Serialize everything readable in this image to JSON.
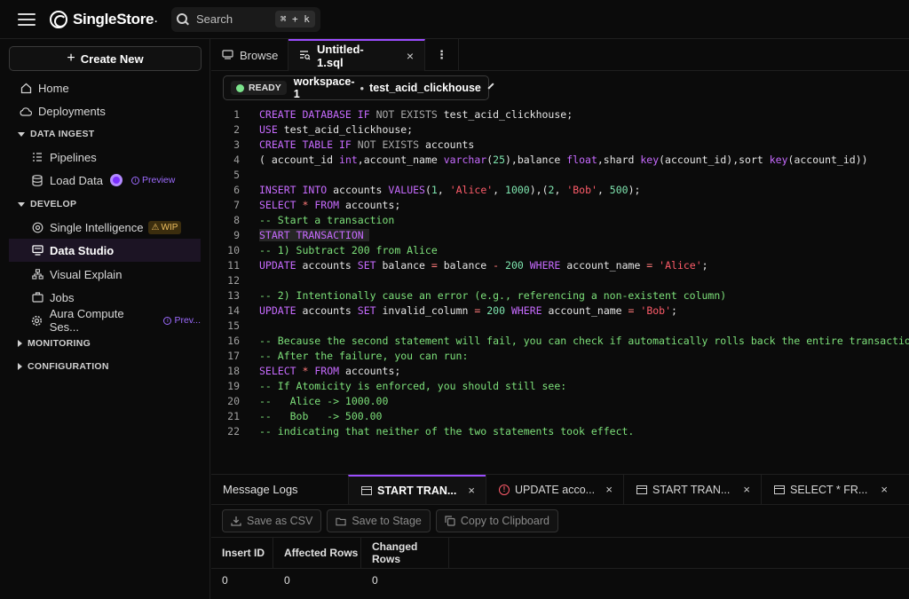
{
  "header": {
    "brand": "SingleStore",
    "brand_mark": ".",
    "search_placeholder": "Search",
    "search_shortcut": "⌘ + k"
  },
  "sidebar": {
    "create_label": "Create New",
    "home": "Home",
    "deployments": "Deployments",
    "section_data_ingest": "DATA INGEST",
    "pipelines": "Pipelines",
    "load_data": "Load Data",
    "load_data_tag": "Preview",
    "section_develop": "DEVELOP",
    "single_intelligence": "Single Intelligence",
    "single_intelligence_tag": "WIP",
    "data_studio": "Data Studio",
    "visual_explain": "Visual Explain",
    "jobs": "Jobs",
    "aura_compute": "Aura Compute Ses...",
    "aura_tag": "Prev...",
    "section_monitoring": "MONITORING",
    "section_configuration": "CONFIGURATION"
  },
  "tabs": {
    "browse": "Browse",
    "file": "Untitled-1.sql",
    "close": "×",
    "more": "⋮"
  },
  "workspace": {
    "status": "READY",
    "name": "workspace-1",
    "separator": "•",
    "database": "test_acid_clickhouse"
  },
  "editor": {
    "line_numbers": [
      "1",
      "2",
      "3",
      "4",
      "5",
      "6",
      "7",
      "8",
      "9",
      "10",
      "11",
      "12",
      "13",
      "14",
      "15",
      "16",
      "17",
      "18",
      "19",
      "20",
      "21",
      "22"
    ],
    "highlight_line": 9
  },
  "bottom": {
    "message_logs": "Message Logs",
    "tabs": [
      {
        "label": "START TRAN...",
        "icon": "table-icon"
      },
      {
        "label": "UPDATE acco...",
        "icon": "error-icon"
      },
      {
        "label": "START TRAN...",
        "icon": "table-icon"
      },
      {
        "label": "SELECT * FR...",
        "icon": "table-icon"
      }
    ],
    "close": "×",
    "save_csv": "Save as CSV",
    "save_stage": "Save to Stage",
    "copy_clipboard": "Copy to Clipboard",
    "columns": [
      "Insert ID",
      "Affected Rows",
      "Changed Rows"
    ],
    "rows": [
      [
        "0",
        "0",
        "0"
      ]
    ]
  },
  "colors": {
    "accent": "#9b4dff",
    "ready": "#7be38b",
    "keyword": "#c76bff",
    "string": "#ff5c6a",
    "number": "#7fe6b0",
    "comment": "#7de07a"
  }
}
